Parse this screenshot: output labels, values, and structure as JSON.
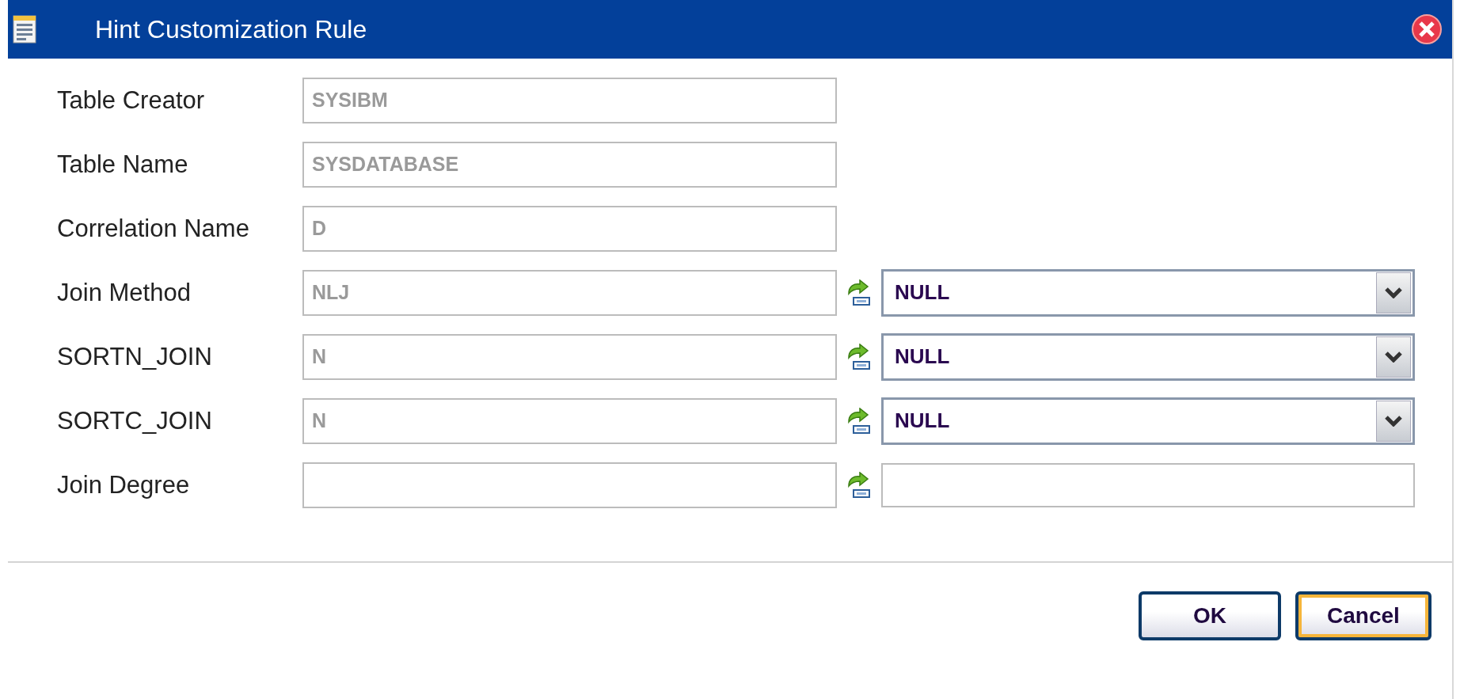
{
  "window": {
    "title": "Hint Customization Rule"
  },
  "rows": [
    {
      "label": "Table Creator",
      "value": "SYSIBM",
      "disabled": true
    },
    {
      "label": "Table Name",
      "value": "SYSDATABASE",
      "disabled": true
    },
    {
      "label": "Correlation Name",
      "value": "D",
      "disabled": true
    },
    {
      "label": "Join Method",
      "value": "NLJ",
      "disabled": true,
      "override": {
        "kind": "select",
        "value": "NULL"
      }
    },
    {
      "label": "SORTN_JOIN",
      "value": "N",
      "disabled": true,
      "override": {
        "kind": "select",
        "value": "NULL"
      }
    },
    {
      "label": "SORTC_JOIN",
      "value": "N",
      "disabled": true,
      "override": {
        "kind": "select",
        "value": "NULL"
      }
    },
    {
      "label": "Join Degree",
      "disabled": true,
      "override": {
        "kind": "text"
      }
    }
  ],
  "buttons": [
    {
      "label": "OK",
      "focused": false
    },
    {
      "label": "Cancel",
      "focused": true
    }
  ]
}
